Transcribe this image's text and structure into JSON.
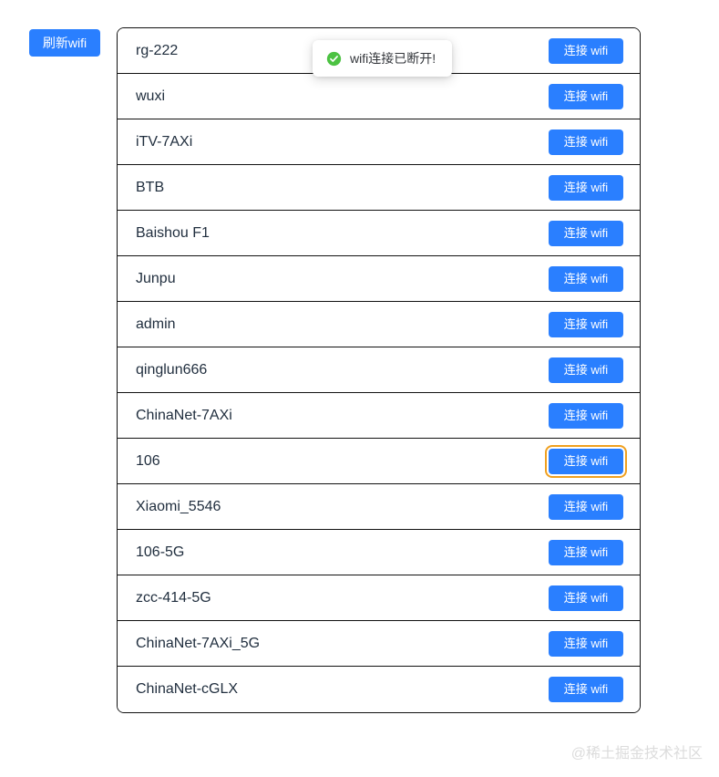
{
  "toolbar": {
    "refresh_label": "刷新wifi"
  },
  "toast": {
    "message": "wifi连接已断开!",
    "icon": "check-circle-icon",
    "icon_color": "#4cc242",
    "visible": true
  },
  "wifi_list": {
    "connect_label": "连接 wifi",
    "focused_index": 9,
    "networks": [
      {
        "ssid": "rg-222"
      },
      {
        "ssid": "wuxi"
      },
      {
        "ssid": "iTV-7AXi"
      },
      {
        "ssid": "BTB"
      },
      {
        "ssid": "Baishou F1"
      },
      {
        "ssid": "Junpu"
      },
      {
        "ssid": "admin"
      },
      {
        "ssid": "qinglun666"
      },
      {
        "ssid": "ChinaNet-7AXi"
      },
      {
        "ssid": "106"
      },
      {
        "ssid": "Xiaomi_5546"
      },
      {
        "ssid": "106-5G"
      },
      {
        "ssid": "zcc-414-5G"
      },
      {
        "ssid": "ChinaNet-7AXi_5G"
      },
      {
        "ssid": "ChinaNet-cGLX"
      }
    ]
  },
  "watermark": {
    "text": "@稀土掘金技术社区"
  },
  "colors": {
    "primary_blue": "#2a7fff",
    "focus_ring": "#f0a020",
    "success_green": "#4cc242",
    "text_dark": "#1f2d3d",
    "border": "#111111"
  }
}
